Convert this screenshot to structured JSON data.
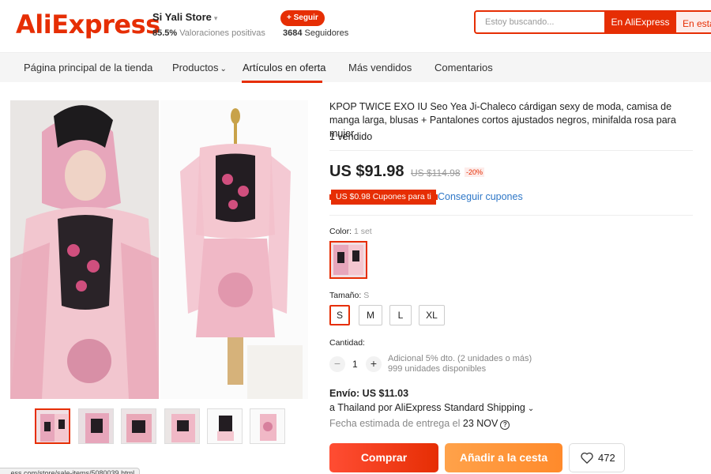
{
  "header": {
    "logo": "AliExpress",
    "store_name": "Si Yali Store",
    "rating_value": "85.5%",
    "rating_label": "Valoraciones positivas",
    "follow_label": "+ Seguir",
    "followers_count": "3684",
    "followers_label": "Seguidores",
    "search_placeholder": "Estoy buscando...",
    "search_aliexpress": "En AliExpress",
    "search_store": "En esta"
  },
  "nav": {
    "items": [
      {
        "label": "Página principal de la tienda"
      },
      {
        "label": "Productos"
      },
      {
        "label": "Artículos en oferta"
      },
      {
        "label": "Más vendidos"
      },
      {
        "label": "Comentarios"
      }
    ],
    "active_index": 2
  },
  "product": {
    "title": "KPOP TWICE EXO IU Seo Yea Ji-Chaleco cárdigan sexy de moda, camisa de manga larga, blusas + Pantalones cortos ajustados negros, minifalda rosa para mujer",
    "sold": "1 vendido",
    "price": "US $91.98",
    "old_price": "US $114.98",
    "discount": "-20%",
    "coupon_badge": "US $0.98 Cupones para ti",
    "coupon_link": "Conseguir cupones",
    "color_label": "Color:",
    "color_value": "1 set",
    "size_label": "Tamaño:",
    "size_value": "S",
    "sizes": [
      "S",
      "M",
      "L",
      "XL"
    ],
    "selected_size": "S",
    "quantity_label": "Cantidad:",
    "quantity": "1",
    "qty_minus": "−",
    "qty_plus": "+",
    "qty_note_1": "Adicional 5% dto. (2 unidades o más)",
    "qty_note_2": "999 unidades disponibles",
    "thumbnail_count": 6
  },
  "shipping": {
    "cost": "Envío: US $11.03",
    "method": "a Thailand por AliExpress Standard Shipping",
    "date_label": "Fecha estimada de entrega el",
    "date_value": "23 NOV"
  },
  "actions": {
    "buy": "Comprar",
    "cart": "Añadir a la cesta",
    "wishlist_count": "472"
  },
  "status_bar": {
    "url": "...ess.com/store/sale-items/5080039.html"
  },
  "colors": {
    "brand": "#e62e04",
    "link": "#2e77c7",
    "cart": "#ff8a2b"
  }
}
